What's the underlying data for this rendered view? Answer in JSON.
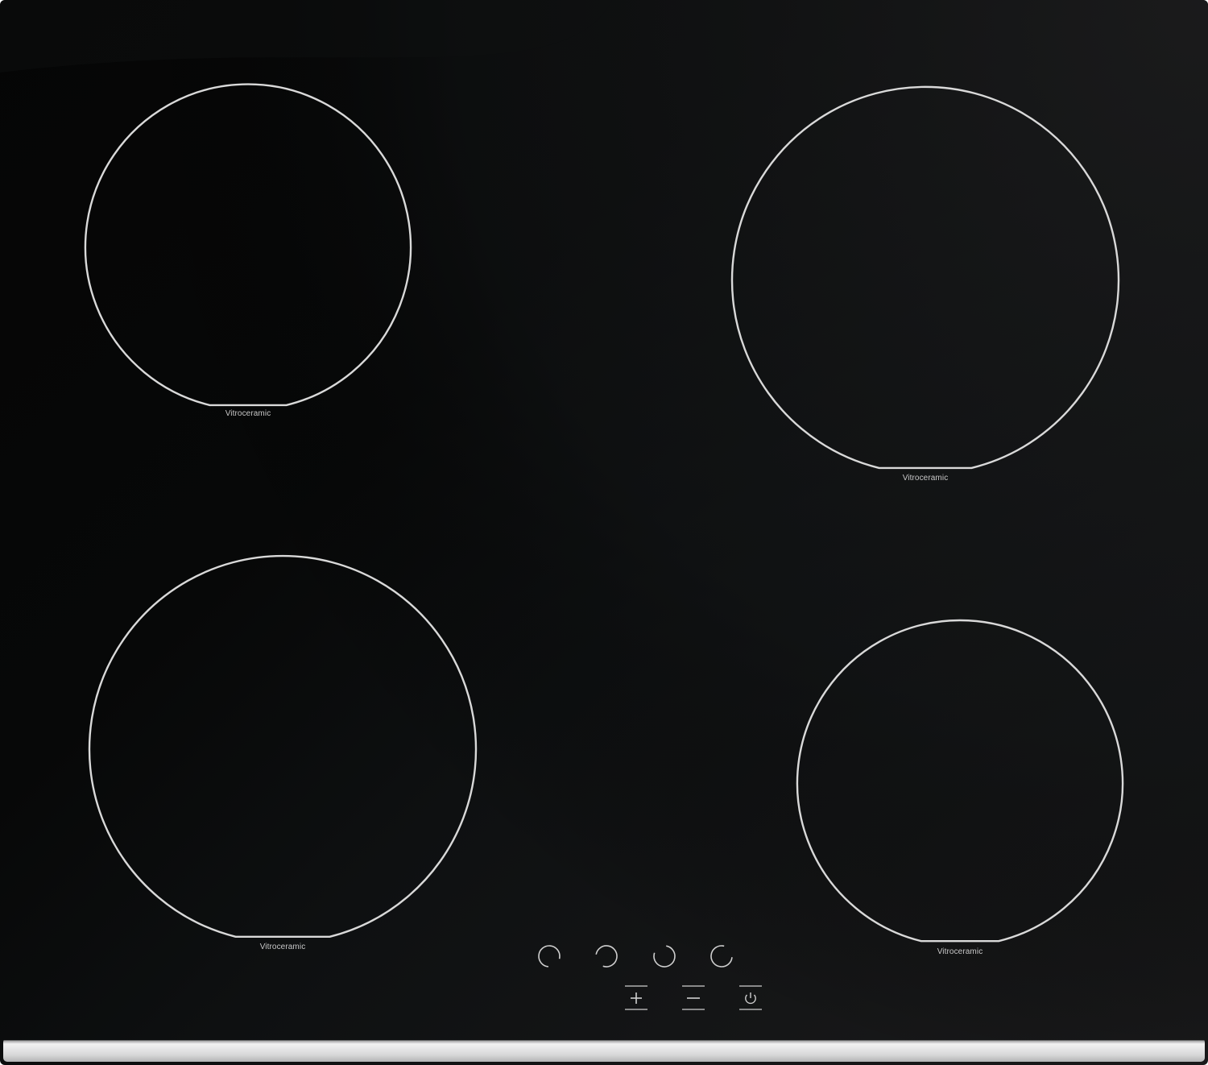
{
  "zones": [
    {
      "id": "rear-left",
      "label": "Vitroceramic"
    },
    {
      "id": "rear-right",
      "label": "Vitroceramic"
    },
    {
      "id": "front-left",
      "label": "Vitroceramic"
    },
    {
      "id": "front-right",
      "label": "Vitroceramic"
    }
  ],
  "controls": {
    "zone_selectors": [
      {
        "icon": "zone-selector-front-left-icon"
      },
      {
        "icon": "zone-selector-rear-left-icon"
      },
      {
        "icon": "zone-selector-rear-right-icon"
      },
      {
        "icon": "zone-selector-front-right-icon"
      }
    ],
    "buttons": [
      {
        "icon": "plus-icon"
      },
      {
        "icon": "minus-icon"
      },
      {
        "icon": "power-icon"
      }
    ]
  },
  "colors": {
    "glass": "#050505",
    "zone_outline": "#d9d9d9",
    "trim": "#e4e4e5"
  }
}
